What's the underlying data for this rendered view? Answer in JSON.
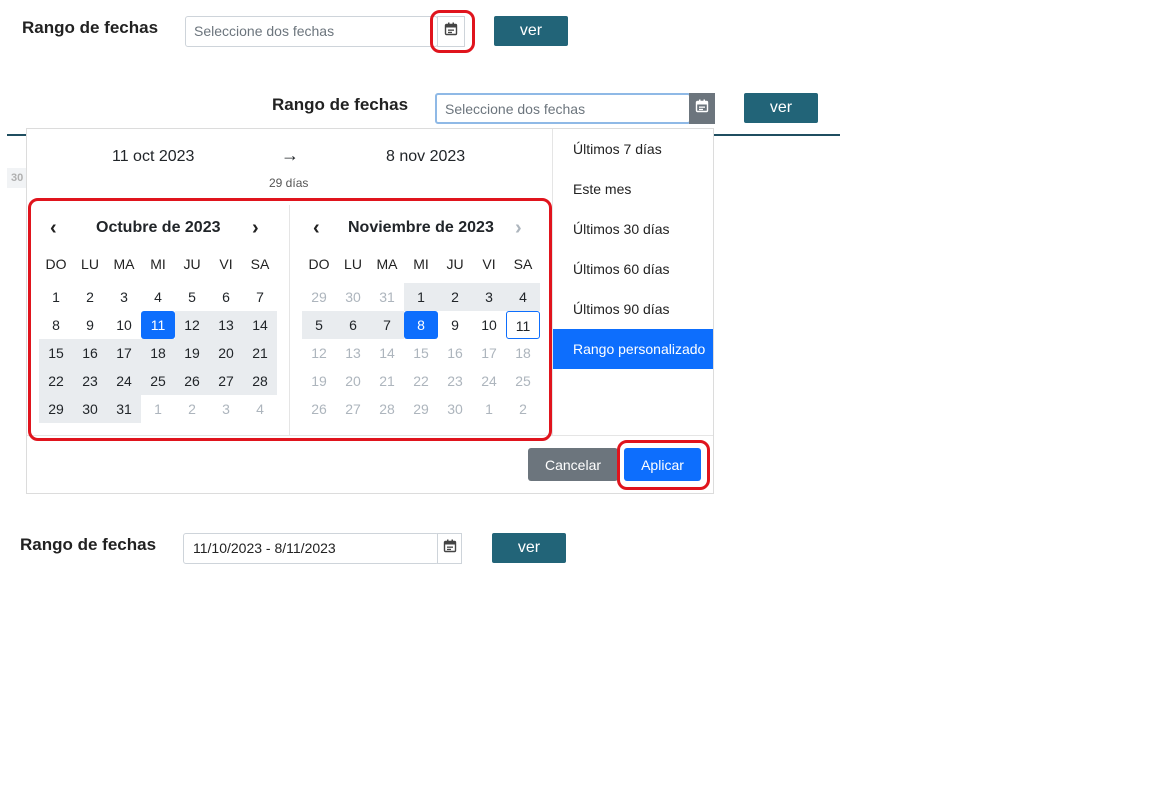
{
  "field_label": "Rango de fechas",
  "placeholder": "Seleccione dos fechas",
  "view_button": "ver",
  "side_number": "30",
  "picker": {
    "start_date": "11 oct 2023",
    "end_date": "8 nov 2023",
    "span": "29 días",
    "arrow": "→",
    "months": [
      {
        "title": "Octubre de 2023",
        "days": [
          "1",
          "2",
          "3",
          "4",
          "5",
          "6",
          "7",
          "8",
          "9",
          "10",
          "11",
          "12",
          "13",
          "14",
          "15",
          "16",
          "17",
          "18",
          "19",
          "20",
          "21",
          "22",
          "23",
          "24",
          "25",
          "26",
          "27",
          "28",
          "29",
          "30",
          "31",
          "1",
          "2",
          "3",
          "4"
        ]
      },
      {
        "title": "Noviembre de 2023",
        "days": [
          "29",
          "30",
          "31",
          "1",
          "2",
          "3",
          "4",
          "5",
          "6",
          "7",
          "8",
          "9",
          "10",
          "11",
          "12",
          "13",
          "14",
          "15",
          "16",
          "17",
          "18",
          "19",
          "20",
          "21",
          "22",
          "23",
          "24",
          "25",
          "26",
          "27",
          "28",
          "29",
          "30",
          "1",
          "2"
        ]
      }
    ],
    "weekdays": [
      "DO",
      "LU",
      "MA",
      "MI",
      "JU",
      "VI",
      "SA"
    ],
    "presets": [
      "Últimos 7 días",
      "Este mes",
      "Últimos 30 días",
      "Últimos 60 días",
      "Últimos 90 días",
      "Rango personalizado"
    ],
    "active_preset": "Rango personalizado",
    "cancel": "Cancelar",
    "apply": "Aplicar"
  },
  "result_value": "11/10/2023 - 8/11/2023",
  "colors": {
    "accent": "#0d6efd",
    "view_button": "#226478",
    "highlight": "#e0141d",
    "range": "#e9ecef"
  }
}
